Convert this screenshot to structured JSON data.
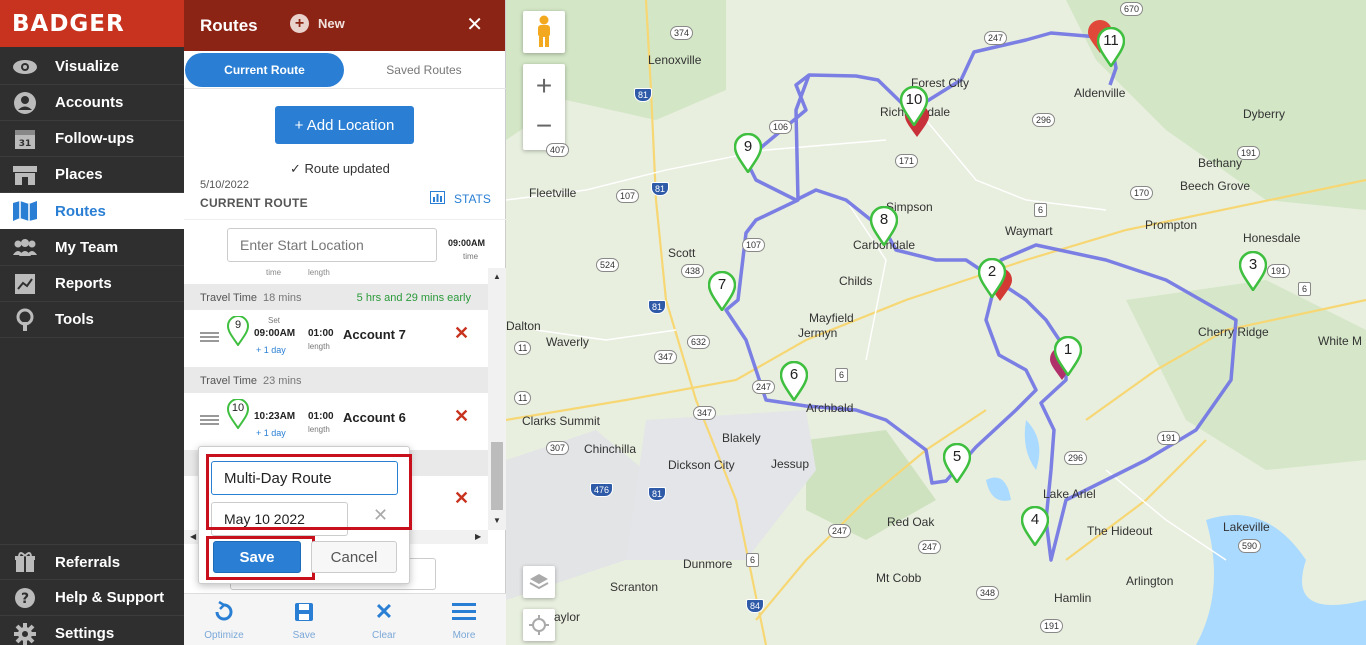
{
  "brand": {
    "logo_text": "BADGER",
    "accent": "#c8331f",
    "blue": "#2a7fd4"
  },
  "nav": {
    "items": [
      {
        "label": "Visualize",
        "icon": "eye-icon"
      },
      {
        "label": "Accounts",
        "icon": "user-icon"
      },
      {
        "label": "Follow-ups",
        "icon": "calendar-icon"
      },
      {
        "label": "Places",
        "icon": "store-icon"
      },
      {
        "label": "Routes",
        "icon": "map-icon",
        "active": true
      },
      {
        "label": "My Team",
        "icon": "team-icon"
      },
      {
        "label": "Reports",
        "icon": "report-icon"
      },
      {
        "label": "Tools",
        "icon": "tools-icon"
      }
    ],
    "bottom": [
      {
        "label": "Referrals",
        "icon": "gift-icon"
      },
      {
        "label": "Help & Support",
        "icon": "help-icon"
      },
      {
        "label": "Settings",
        "icon": "gear-icon"
      }
    ]
  },
  "panel": {
    "title": "Routes",
    "new_label": "New",
    "tabs": {
      "current": "Current Route",
      "saved": "Saved Routes"
    },
    "add_location": "+ Add Location",
    "route_updated": "Route updated",
    "date": "5/10/2022",
    "route_label": "CURRENT ROUTE",
    "stats": "STATS",
    "start_placeholder": "Enter Start Location",
    "start_time": "09:00AM",
    "start_time_label": "time",
    "frag_time": "time",
    "frag_length": "length",
    "travel_rows": [
      {
        "label": "Travel Time",
        "value": "18 mins",
        "note": "5 hrs and 29 mins early"
      },
      {
        "label": "Travel Time",
        "value": "23 mins",
        "note": ""
      }
    ],
    "stops": [
      {
        "num": "9",
        "set": "Set",
        "arrive": "09:00AM",
        "plus_day": "+ 1 day",
        "length": "01:00",
        "length_label": "length",
        "name": "Account 7"
      },
      {
        "num": "10",
        "set": "",
        "arrive": "10:23AM",
        "plus_day": "+ 1 day",
        "length": "01:00",
        "length_label": "length",
        "name": "Account 6"
      }
    ]
  },
  "save_popup": {
    "name_value": "Multi-Day Route",
    "date_value": "May 10 2022",
    "save_label": "Save",
    "cancel_label": "Cancel"
  },
  "toolbar": [
    {
      "label": "Optimize",
      "icon": "optimize-icon"
    },
    {
      "label": "Save",
      "icon": "save-icon"
    },
    {
      "label": "Clear",
      "icon": "clear-icon"
    },
    {
      "label": "More",
      "icon": "menu-icon"
    }
  ],
  "map": {
    "places": [
      "Lenoxville",
      "Forest City",
      "Richmondale",
      "Aldenville",
      "Dyberry",
      "Bethany",
      "Beech Grove",
      "Fleetville",
      "Simpson",
      "Carbondale",
      "Waymart",
      "Prompton",
      "Honesdale",
      "Scott",
      "Childs",
      "Mayfield",
      "Jermyn",
      "Cherry Ridge",
      "White M",
      "Dalton",
      "Waverly",
      "Archbald",
      "Clarks Summit",
      "Blakely",
      "Chinchilla",
      "Dickson City",
      "Jessup",
      "Lake Ariel",
      "The Hideout",
      "Lakeville",
      "Red Oak",
      "Dunmore",
      "Arlington",
      "Mt Cobb",
      "Scranton",
      "Hamlin",
      "aylor"
    ],
    "shields": [
      "374",
      "247",
      "670",
      "81",
      "106",
      "171",
      "296",
      "191",
      "407",
      "81",
      "107",
      "170",
      "6",
      "438",
      "524",
      "191",
      "6",
      "632",
      "247",
      "347",
      "6",
      "11",
      "81",
      "347",
      "307",
      "476",
      "81",
      "296",
      "247",
      "590",
      "6",
      "247",
      "348",
      "84",
      "191",
      "191",
      "11",
      "107"
    ],
    "markers": [
      "1",
      "2",
      "3",
      "4",
      "5",
      "6",
      "7",
      "8",
      "9",
      "10",
      "11"
    ],
    "route_color": "#6f72e4",
    "marker_color": "#3fbf3f"
  }
}
